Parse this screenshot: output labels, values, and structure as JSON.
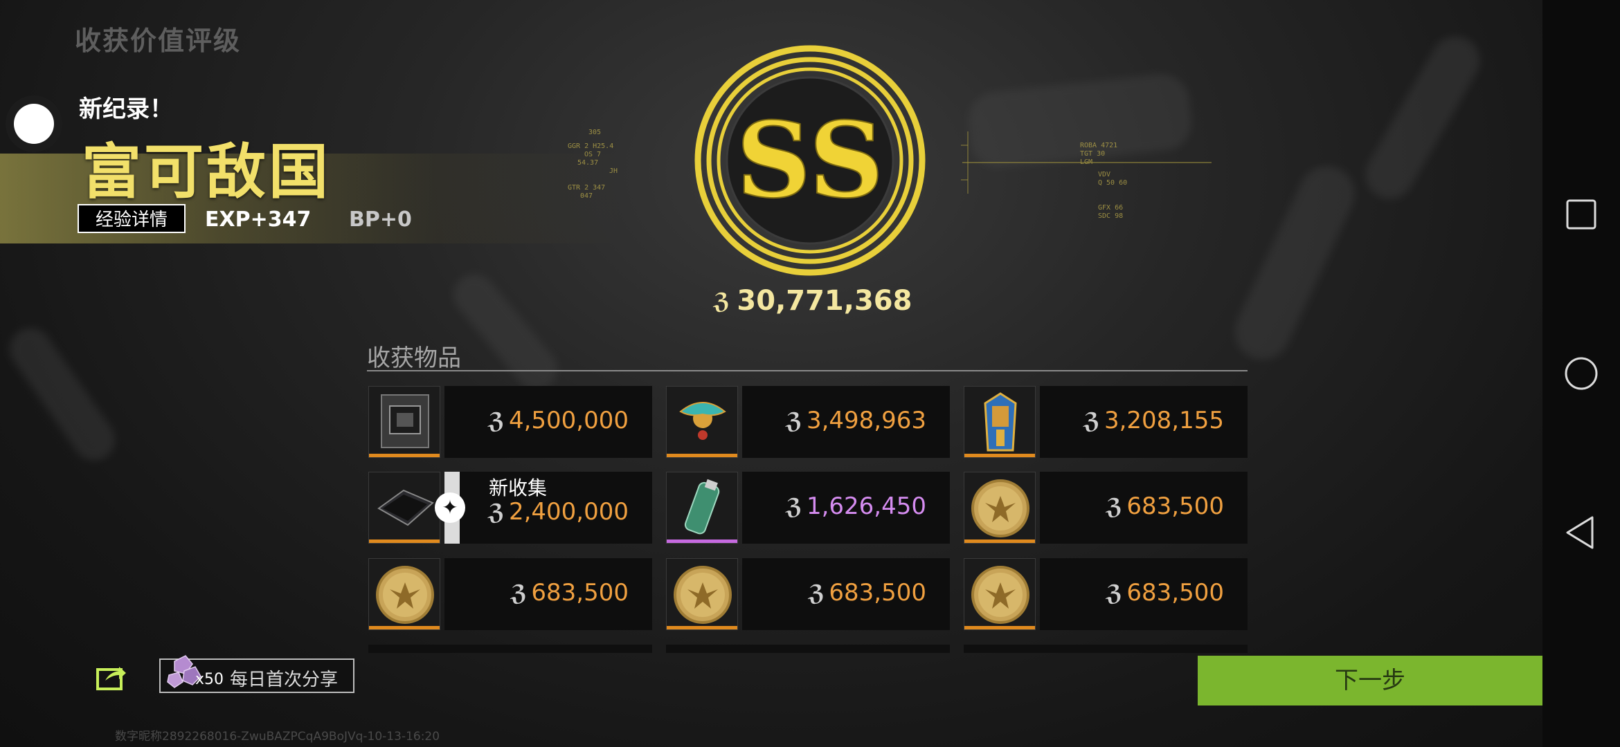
{
  "page_title": "收获价值评级",
  "record": {
    "label": "新纪录！",
    "title": "富可敌国"
  },
  "exp": {
    "details_button": "经验详情",
    "exp_value": "EXP+347",
    "bp_value": "BP+0"
  },
  "rating": {
    "grade": "SS",
    "total_value": "30,771,368"
  },
  "hud_left": [
    "305",
    "GGR 2 H25.4",
    "OS 7",
    "54.37",
    "JH",
    "GTR 2 347",
    "047"
  ],
  "hud_right": [
    "ROBA 4721",
    "TGT 30",
    "LGM",
    "VDV",
    "Q 50 60",
    "GFX 66",
    "SDC 98"
  ],
  "harvest": {
    "section_title": "收获物品",
    "items": [
      {
        "name": "server-case",
        "value": "4,500,000",
        "rarity_color": "#e08a1e",
        "value_color": "#f0a040",
        "new_label": ""
      },
      {
        "name": "scarab-necklace",
        "value": "3,498,963",
        "rarity_color": "#e08a1e",
        "value_color": "#f0a040",
        "new_label": ""
      },
      {
        "name": "pharaoh-bust",
        "value": "3,208,155",
        "rarity_color": "#e08a1e",
        "value_color": "#f0a040",
        "new_label": ""
      },
      {
        "name": "tablet-device",
        "value": "2,400,000",
        "rarity_color": "#e08a1e",
        "value_color": "#f0a040",
        "new_label": "新收集"
      },
      {
        "name": "jade-vial",
        "value": "1,626,450",
        "rarity_color": "#c66ae0",
        "value_color": "#d58cf0",
        "new_label": ""
      },
      {
        "name": "gold-coin",
        "value": "683,500",
        "rarity_color": "#e08a1e",
        "value_color": "#f0a040",
        "new_label": ""
      },
      {
        "name": "gold-coin",
        "value": "683,500",
        "rarity_color": "#e08a1e",
        "value_color": "#f0a040",
        "new_label": ""
      },
      {
        "name": "gold-coin",
        "value": "683,500",
        "rarity_color": "#e08a1e",
        "value_color": "#f0a040",
        "new_label": ""
      },
      {
        "name": "gold-coin",
        "value": "683,500",
        "rarity_color": "#e08a1e",
        "value_color": "#f0a040",
        "new_label": ""
      }
    ]
  },
  "share": {
    "gem_count": "x50",
    "label": "每日首次分享"
  },
  "next_button": "下一步",
  "footer_id": "数字昵称2892268016-ZwuBAZPCqA9BoJVq-10-13-16:20",
  "colors": {
    "accent_green": "#7bb62e",
    "gold": "#f2e06a",
    "orange": "#f0a040",
    "purple": "#d58cf0"
  }
}
